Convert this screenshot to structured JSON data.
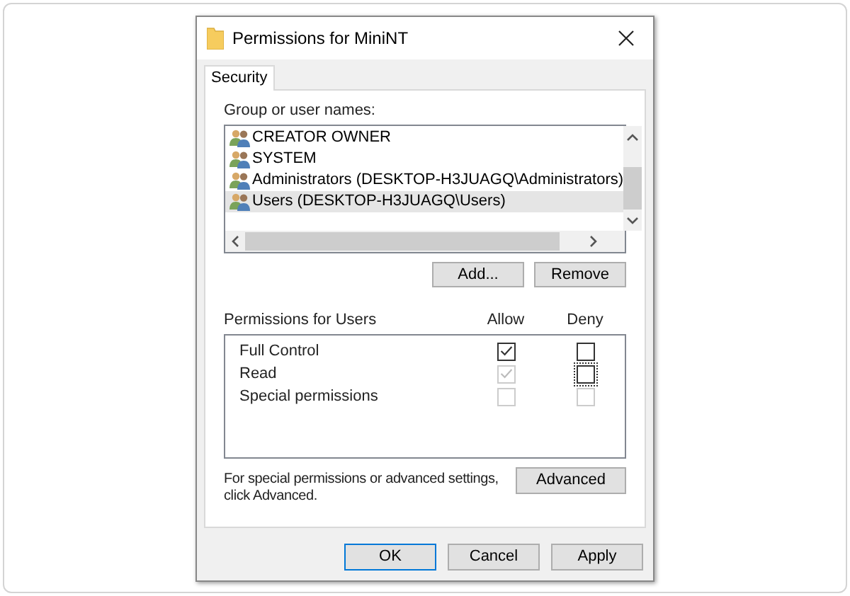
{
  "window": {
    "title": "Permissions for MiniNT"
  },
  "tabs": [
    {
      "label": "Security",
      "selected": true
    }
  ],
  "group_label": "Group or user names:",
  "users": [
    {
      "name": "CREATOR OWNER",
      "selected": false
    },
    {
      "name": "SYSTEM",
      "selected": false
    },
    {
      "name": "Administrators (DESKTOP-H3JUAGQ\\Administrators)",
      "selected": false
    },
    {
      "name": "Users (DESKTOP-H3JUAGQ\\Users)",
      "selected": true
    }
  ],
  "user_buttons": [
    {
      "label": "Add..."
    },
    {
      "label": "Remove"
    }
  ],
  "permissions": {
    "title": "Permissions for Users",
    "allow_header": "Allow",
    "deny_header": "Deny",
    "rows": [
      {
        "name": "Full Control",
        "allow": {
          "checked": true,
          "disabled": false,
          "focused": false
        },
        "deny": {
          "checked": false,
          "disabled": false,
          "focused": false
        }
      },
      {
        "name": "Read",
        "allow": {
          "checked": true,
          "disabled": true,
          "focused": false
        },
        "deny": {
          "checked": false,
          "disabled": false,
          "focused": true
        }
      },
      {
        "name": "Special permissions",
        "allow": {
          "checked": false,
          "disabled": true,
          "focused": false
        },
        "deny": {
          "checked": false,
          "disabled": true,
          "focused": false
        }
      }
    ]
  },
  "advanced_note": "For special permissions or advanced settings, click Advanced.",
  "advanced_button": "Advanced",
  "buttons": [
    {
      "label": "OK",
      "default": true
    },
    {
      "label": "Cancel",
      "default": false
    },
    {
      "label": "Apply",
      "default": false
    }
  ]
}
